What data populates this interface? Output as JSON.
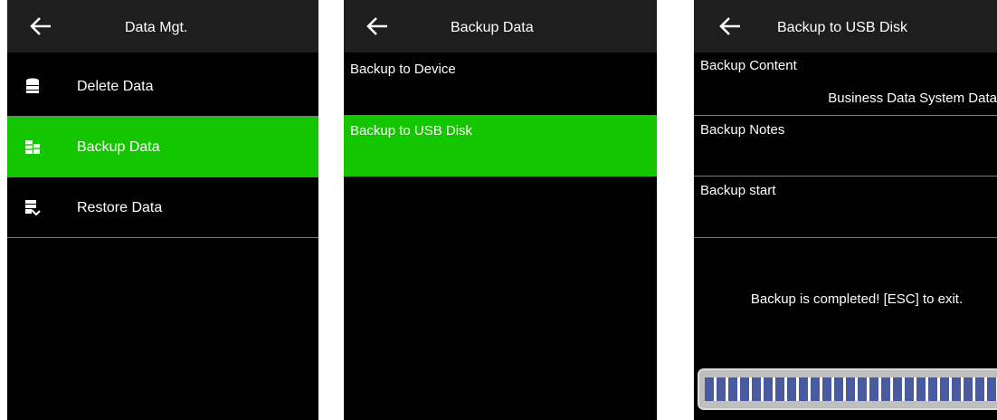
{
  "screens": [
    {
      "title": "Data Mgt.",
      "items": [
        {
          "label": "Delete Data",
          "icon": "database-icon",
          "active": false
        },
        {
          "label": "Backup Data",
          "icon": "backup-database-icon",
          "active": true
        },
        {
          "label": "Restore Data",
          "icon": "restore-database-icon",
          "active": false
        }
      ]
    },
    {
      "title": "Backup Data",
      "options": [
        {
          "label": "Backup to Device",
          "active": false
        },
        {
          "label": "Backup to USB Disk",
          "active": true
        }
      ]
    },
    {
      "title": "Backup to USB Disk",
      "backup_content_label": "Backup Content",
      "backup_content_value": "Business Data System Data",
      "backup_notes_label": "Backup Notes",
      "backup_start_label": "Backup start",
      "status_message": "Backup is completed! [ESC] to exit.",
      "progress_percent": 100
    }
  ],
  "colors": {
    "highlight": "#13c600",
    "titlebar": "#1e1e1e",
    "background": "#000000",
    "progress_segment": "#4a5aa0"
  }
}
